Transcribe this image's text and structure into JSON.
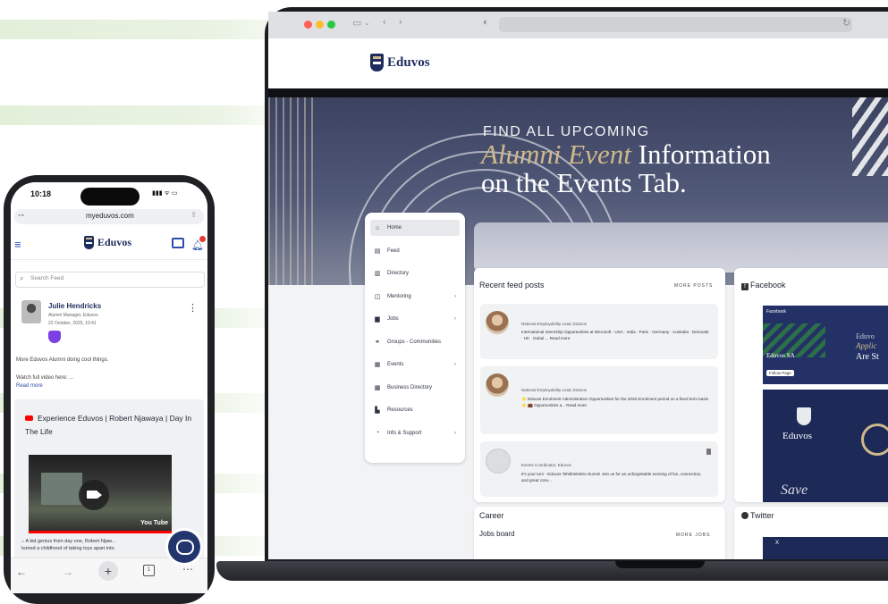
{
  "colors": {
    "brand_navy": "#1e2c5e",
    "hero_bg": "#464d6b",
    "accent_gold": "#cfb98b",
    "notification_red": "#e53935",
    "badge_purple": "#7b3fe4",
    "youtube_red": "#ff0000",
    "deco_green": "#e6f1df"
  },
  "laptop": {
    "browser": {
      "traffic_lights": [
        "#ff5f57",
        "#febc2e",
        "#28c840"
      ],
      "icons": [
        "sidebar-icon",
        "chevron-down-icon",
        "back-arrow-icon",
        "forward-arrow-icon",
        "privacy-icon",
        "reload-icon"
      ]
    },
    "site": {
      "logo_text": "Eduvos",
      "hero": {
        "line1": "FIND ALL UPCOMING",
        "line2_accent": "Alumni Event",
        "line2_rest": "Information",
        "line3": "on the Events Tab."
      },
      "nav": [
        {
          "label": "Home",
          "icon": "home-icon",
          "active": true,
          "has_chevron": false
        },
        {
          "label": "Feed",
          "icon": "feed-icon",
          "active": false,
          "has_chevron": false
        },
        {
          "label": "Directory",
          "icon": "directory-icon",
          "active": false,
          "has_chevron": false
        },
        {
          "label": "Mentoring",
          "icon": "mentoring-icon",
          "active": false,
          "has_chevron": true
        },
        {
          "label": "Jobs",
          "icon": "briefcase-icon",
          "active": false,
          "has_chevron": true
        },
        {
          "label": "Groups - Communities",
          "icon": "groups-icon",
          "active": false,
          "has_chevron": false
        },
        {
          "label": "Events",
          "icon": "calendar-icon",
          "active": false,
          "has_chevron": true
        },
        {
          "label": "Business Directory",
          "icon": "business-icon",
          "active": false,
          "has_chevron": false
        },
        {
          "label": "Resources",
          "icon": "resources-icon",
          "active": false,
          "has_chevron": false
        },
        {
          "label": "Info & Support",
          "icon": "support-icon",
          "active": false,
          "has_chevron": true
        }
      ],
      "feed": {
        "title": "Recent feed posts",
        "more": "MORE POSTS",
        "posts": [
          {
            "role": "National Employability Lead, Eduvos",
            "text": "International Internship Opportunities at Microsoft - USA · India · Paris · Germany · Australia · Denmark · UK · Dubai ... Read more"
          },
          {
            "role": "National Employability Lead, Eduvos",
            "text": "⭐ Eduvos Enrolment Administration Opportunities for the 2026 Enrolment period on a fixed term basis ⭐ 💼 Opportunities a... Read more"
          },
          {
            "role": "Events Coordinator, Eduvos",
            "text": "It's your turn - Eduvos Tshikhelelelo Alumni! Join us for an unforgettable evening of fun, connection, and great conv..."
          }
        ]
      },
      "facebook": {
        "title": "Facebook",
        "embed_page": "Facebook",
        "follow_button": "Follow Page",
        "embed_text_1": "Eduvos SA",
        "embed_text_2": "Eduvos",
        "embed_right_1": "Eduvo",
        "embed_right_2": "Applic",
        "embed_right_3": "Are St",
        "embed_save": "Save"
      },
      "career": {
        "title": "Career",
        "subtitle": "Jobs board",
        "more": "MORE JOBS"
      },
      "twitter": {
        "title": "Twitter",
        "embed_label": "X"
      }
    }
  },
  "phone": {
    "status": {
      "time": "10:18",
      "signal": "▮▮▮ ᯤ ▭"
    },
    "url": "myeduvos.com",
    "logo_text": "Eduvos",
    "search_placeholder": "Search Feed",
    "post": {
      "author": "Julie Hendricks",
      "role": "Alumni Manager, Eduvos",
      "date": "22 October, 2025, 10:41",
      "body": "More Eduvos Alumni doing cool things.",
      "watch": "Watch full video here: ...",
      "read_more": "Read more",
      "video_title": "Experience Eduvos | Robert Njawaya | Day In The Life",
      "caption": "A kid genius from day one, Robert Njaw...",
      "caption2": "turned a childhood of taking toys apart into",
      "youtube_label": "You Tube"
    },
    "tab_count": "1"
  }
}
